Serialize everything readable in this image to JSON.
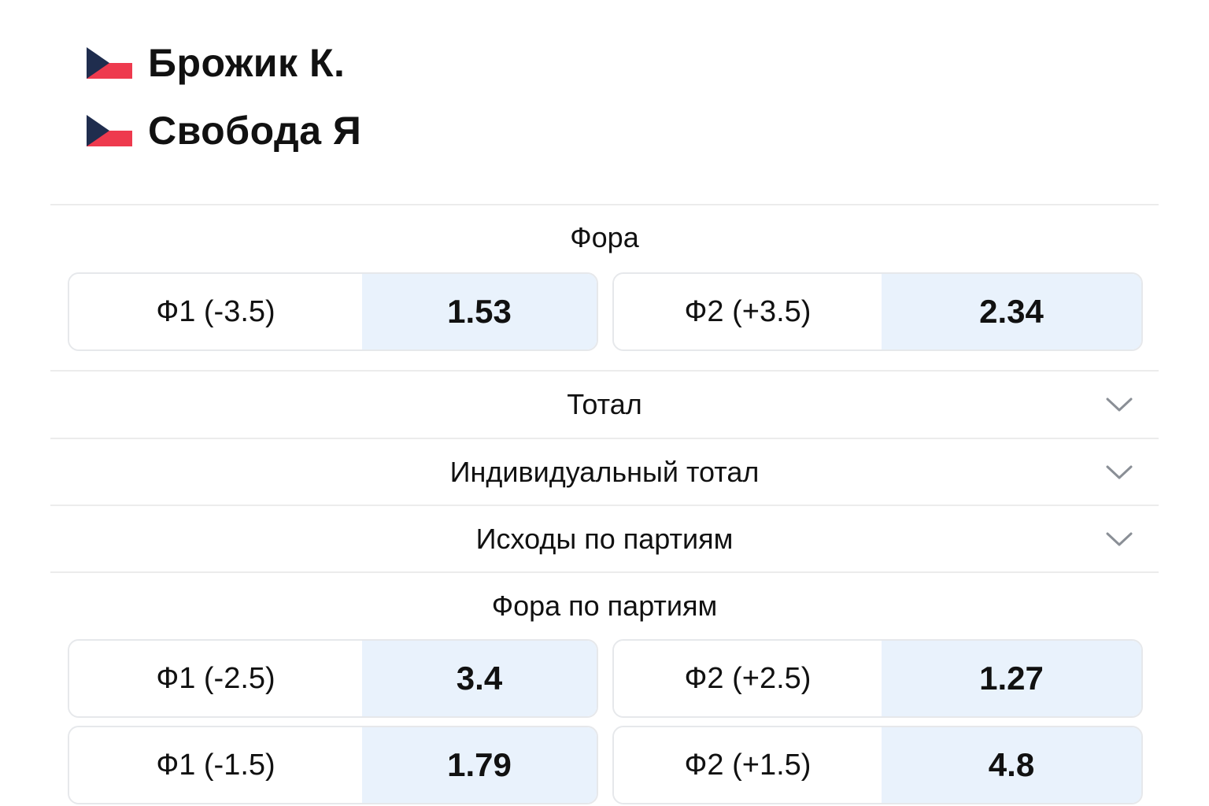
{
  "players": [
    {
      "name": "Брожик К.",
      "flag": "czech-flag-icon"
    },
    {
      "name": "Свобода Я",
      "flag": "czech-flag-icon"
    }
  ],
  "colors": {
    "odds_value_bg": "#e9f2fc",
    "flag_white": "#ffffff",
    "flag_red": "#ee3a4e",
    "flag_blue": "#1f2d4e",
    "divider": "#ececec"
  },
  "markets": {
    "handicap": {
      "title": "Фора",
      "outcomes": [
        {
          "label": "Ф1 (-3.5)",
          "odds": "1.53"
        },
        {
          "label": "Ф2 (+3.5)",
          "odds": "2.34"
        }
      ]
    },
    "total": {
      "title": "Тотал",
      "icon": "chevron-down-icon"
    },
    "individual_total": {
      "title": "Индивидуальный тотал",
      "icon": "chevron-down-icon"
    },
    "set_outcomes": {
      "title": "Исходы по партиям",
      "icon": "chevron-down-icon"
    },
    "set_handicap": {
      "title": "Фора по партиям",
      "rows": [
        [
          {
            "label": "Ф1 (-2.5)",
            "odds": "3.4"
          },
          {
            "label": "Ф2 (+2.5)",
            "odds": "1.27"
          }
        ],
        [
          {
            "label": "Ф1 (-1.5)",
            "odds": "1.79"
          },
          {
            "label": "Ф2 (+1.5)",
            "odds": "4.8"
          }
        ]
      ]
    }
  }
}
